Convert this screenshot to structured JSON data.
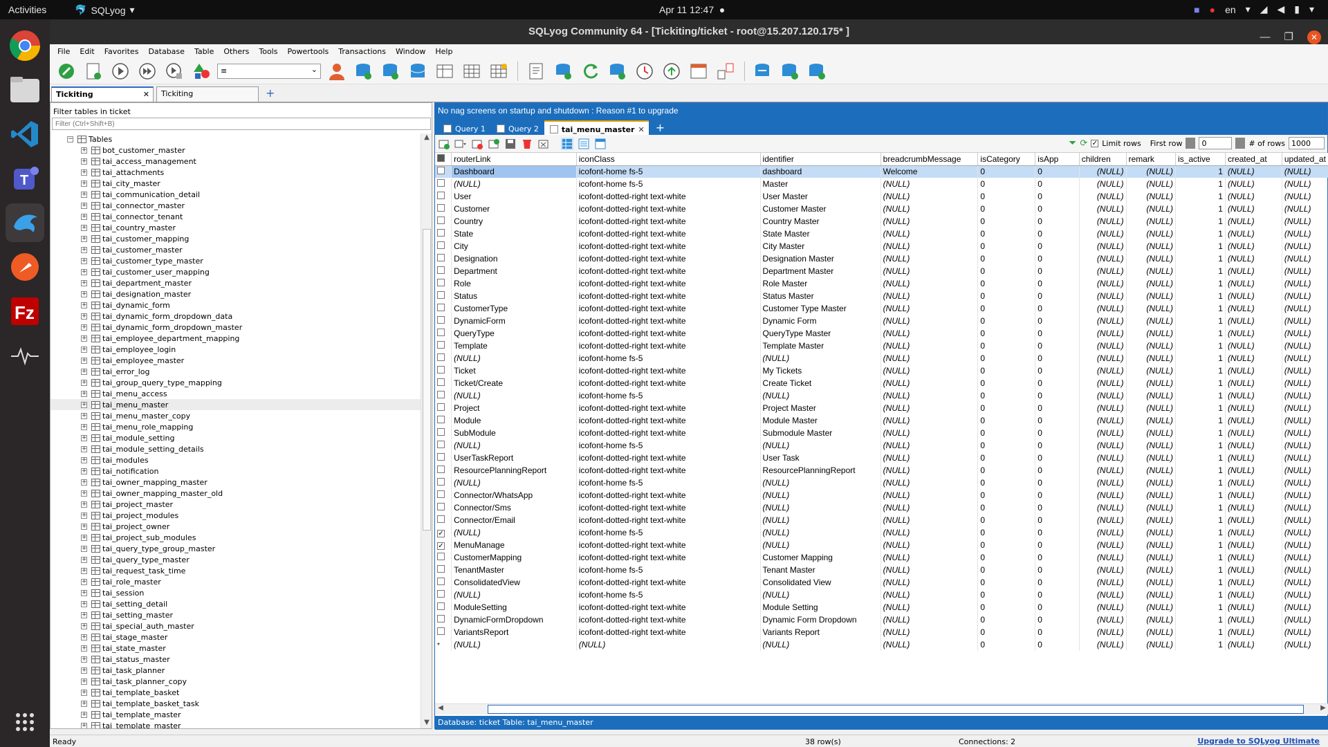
{
  "topbar": {
    "activities": "Activities",
    "app": "SQLyog",
    "clock": "Apr 11  12:47",
    "lang": "en"
  },
  "window": {
    "title": "SQLyog Community 64 - [Tickiting/ticket - root@15.207.120.175* ]"
  },
  "menu": [
    "File",
    "Edit",
    "Favorites",
    "Database",
    "Table",
    "Others",
    "Tools",
    "Powertools",
    "Transactions",
    "Window",
    "Help"
  ],
  "conn_tabs": [
    {
      "label": "Tickiting"
    },
    {
      "label": "Tickiting"
    }
  ],
  "left": {
    "filter_header": "Filter tables in ticket",
    "filter_placeholder": "Filter (Ctrl+Shift+B)",
    "root": "Tables",
    "tables": [
      "bot_customer_master",
      "tai_access_management",
      "tai_attachments",
      "tai_city_master",
      "tai_communication_detail",
      "tai_connector_master",
      "tai_connector_tenant",
      "tai_country_master",
      "tai_customer_mapping",
      "tai_customer_master",
      "tai_customer_type_master",
      "tai_customer_user_mapping",
      "tai_department_master",
      "tai_designation_master",
      "tai_dynamic_form",
      "tai_dynamic_form_dropdown_data",
      "tai_dynamic_form_dropdown_master",
      "tai_employee_department_mapping",
      "tai_employee_login",
      "tai_employee_master",
      "tai_error_log",
      "tai_group_query_type_mapping",
      "tai_menu_access",
      "tai_menu_master",
      "tai_menu_master_copy",
      "tai_menu_role_mapping",
      "tai_module_setting",
      "tai_module_setting_details",
      "tai_modules",
      "tai_notification",
      "tai_owner_mapping_master",
      "tai_owner_mapping_master_old",
      "tai_project_master",
      "tai_project_modules",
      "tai_project_owner",
      "tai_project_sub_modules",
      "tai_query_type_group_master",
      "tai_query_type_master",
      "tai_request_task_time",
      "tai_role_master",
      "tai_session",
      "tai_setting_detail",
      "tai_setting_master",
      "tai_special_auth_master",
      "tai_stage_master",
      "tai_state_master",
      "tai_status_master",
      "tai_task_planner",
      "tai_task_planner_copy",
      "tai_template_basket",
      "tai_template_basket_task",
      "tai_template_master",
      "tai_template_master"
    ],
    "selected_table": "tai_menu_master"
  },
  "right": {
    "nag": "No nag screens on startup and shutdown : Reason #1 to upgrade",
    "query_tabs": [
      "Query 1",
      "Query 2",
      "tai_menu_master"
    ],
    "limit_rows_label": "Limit rows",
    "first_row_label": "First row",
    "first_row_value": "0",
    "rows_label": "# of rows",
    "rows_value": "1000",
    "columns": [
      "routerLink",
      "iconClass",
      "identifier",
      "breadcrumbMessage",
      "isCategory",
      "isApp",
      "children",
      "remark",
      "is_active",
      "created_at",
      "updated_at"
    ],
    "rows": [
      [
        "Dashboard",
        "icofont-home fs-5",
        "dashboard",
        "Welcome",
        "0",
        "0",
        "(NULL)",
        "(NULL)",
        "1",
        "(NULL)",
        "(NULL)"
      ],
      [
        "(NULL)",
        "icofont-home fs-5",
        "Master",
        "(NULL)",
        "0",
        "0",
        "(NULL)",
        "(NULL)",
        "1",
        "(NULL)",
        "(NULL)"
      ],
      [
        "User",
        "icofont-dotted-right text-white",
        "User Master",
        "(NULL)",
        "0",
        "0",
        "(NULL)",
        "(NULL)",
        "1",
        "(NULL)",
        "(NULL)"
      ],
      [
        "Customer",
        "icofont-dotted-right text-white",
        "Customer Master",
        "(NULL)",
        "0",
        "0",
        "(NULL)",
        "(NULL)",
        "1",
        "(NULL)",
        "(NULL)"
      ],
      [
        "Country",
        "icofont-dotted-right text-white",
        "Country Master",
        "(NULL)",
        "0",
        "0",
        "(NULL)",
        "(NULL)",
        "1",
        "(NULL)",
        "(NULL)"
      ],
      [
        "State",
        "icofont-dotted-right text-white",
        "State Master",
        "(NULL)",
        "0",
        "0",
        "(NULL)",
        "(NULL)",
        "1",
        "(NULL)",
        "(NULL)"
      ],
      [
        "City",
        "icofont-dotted-right text-white",
        "City Master",
        "(NULL)",
        "0",
        "0",
        "(NULL)",
        "(NULL)",
        "1",
        "(NULL)",
        "(NULL)"
      ],
      [
        "Designation",
        "icofont-dotted-right text-white",
        "Designation Master",
        "(NULL)",
        "0",
        "0",
        "(NULL)",
        "(NULL)",
        "1",
        "(NULL)",
        "(NULL)"
      ],
      [
        "Department",
        "icofont-dotted-right text-white",
        "Department Master",
        "(NULL)",
        "0",
        "0",
        "(NULL)",
        "(NULL)",
        "1",
        "(NULL)",
        "(NULL)"
      ],
      [
        "Role",
        "icofont-dotted-right text-white",
        "Role Master",
        "(NULL)",
        "0",
        "0",
        "(NULL)",
        "(NULL)",
        "1",
        "(NULL)",
        "(NULL)"
      ],
      [
        "Status",
        "icofont-dotted-right text-white",
        "Status Master",
        "(NULL)",
        "0",
        "0",
        "(NULL)",
        "(NULL)",
        "1",
        "(NULL)",
        "(NULL)"
      ],
      [
        "CustomerType",
        "icofont-dotted-right text-white",
        "Customer Type Master",
        "(NULL)",
        "0",
        "0",
        "(NULL)",
        "(NULL)",
        "1",
        "(NULL)",
        "(NULL)"
      ],
      [
        "DynamicForm",
        "icofont-dotted-right text-white",
        "Dynamic Form",
        "(NULL)",
        "0",
        "0",
        "(NULL)",
        "(NULL)",
        "1",
        "(NULL)",
        "(NULL)"
      ],
      [
        "QueryType",
        "icofont-dotted-right text-white",
        "QueryType Master",
        "(NULL)",
        "0",
        "0",
        "(NULL)",
        "(NULL)",
        "1",
        "(NULL)",
        "(NULL)"
      ],
      [
        "Template",
        "icofont-dotted-right text-white",
        "Template Master",
        "(NULL)",
        "0",
        "0",
        "(NULL)",
        "(NULL)",
        "1",
        "(NULL)",
        "(NULL)"
      ],
      [
        "(NULL)",
        "icofont-home fs-5",
        "(NULL)",
        "(NULL)",
        "0",
        "0",
        "(NULL)",
        "(NULL)",
        "1",
        "(NULL)",
        "(NULL)"
      ],
      [
        "Ticket",
        "icofont-dotted-right text-white",
        "My Tickets",
        "(NULL)",
        "0",
        "0",
        "(NULL)",
        "(NULL)",
        "1",
        "(NULL)",
        "(NULL)"
      ],
      [
        "Ticket/Create",
        "icofont-dotted-right text-white",
        "Create Ticket",
        "(NULL)",
        "0",
        "0",
        "(NULL)",
        "(NULL)",
        "1",
        "(NULL)",
        "(NULL)"
      ],
      [
        "(NULL)",
        "icofont-home fs-5",
        "(NULL)",
        "(NULL)",
        "0",
        "0",
        "(NULL)",
        "(NULL)",
        "1",
        "(NULL)",
        "(NULL)"
      ],
      [
        "Project",
        "icofont-dotted-right text-white",
        "Project Master",
        "(NULL)",
        "0",
        "0",
        "(NULL)",
        "(NULL)",
        "1",
        "(NULL)",
        "(NULL)"
      ],
      [
        "Module",
        "icofont-dotted-right text-white",
        "Module Master",
        "(NULL)",
        "0",
        "0",
        "(NULL)",
        "(NULL)",
        "1",
        "(NULL)",
        "(NULL)"
      ],
      [
        "SubModule",
        "icofont-dotted-right text-white",
        "Submodule Master",
        "(NULL)",
        "0",
        "0",
        "(NULL)",
        "(NULL)",
        "1",
        "(NULL)",
        "(NULL)"
      ],
      [
        "(NULL)",
        "icofont-home fs-5",
        "(NULL)",
        "(NULL)",
        "0",
        "0",
        "(NULL)",
        "(NULL)",
        "1",
        "(NULL)",
        "(NULL)"
      ],
      [
        "UserTaskReport",
        "icofont-dotted-right text-white",
        "User Task",
        "(NULL)",
        "0",
        "0",
        "(NULL)",
        "(NULL)",
        "1",
        "(NULL)",
        "(NULL)"
      ],
      [
        "ResourcePlanningReport",
        "icofont-dotted-right text-white",
        "ResourcePlanningReport",
        "(NULL)",
        "0",
        "0",
        "(NULL)",
        "(NULL)",
        "1",
        "(NULL)",
        "(NULL)"
      ],
      [
        "(NULL)",
        "icofont-home fs-5",
        "(NULL)",
        "(NULL)",
        "0",
        "0",
        "(NULL)",
        "(NULL)",
        "1",
        "(NULL)",
        "(NULL)"
      ],
      [
        "Connector/WhatsApp",
        "icofont-dotted-right text-white",
        "(NULL)",
        "(NULL)",
        "0",
        "0",
        "(NULL)",
        "(NULL)",
        "1",
        "(NULL)",
        "(NULL)"
      ],
      [
        "Connector/Sms",
        "icofont-dotted-right text-white",
        "(NULL)",
        "(NULL)",
        "0",
        "0",
        "(NULL)",
        "(NULL)",
        "1",
        "(NULL)",
        "(NULL)"
      ],
      [
        "Connector/Email",
        "icofont-dotted-right text-white",
        "(NULL)",
        "(NULL)",
        "0",
        "0",
        "(NULL)",
        "(NULL)",
        "1",
        "(NULL)",
        "(NULL)"
      ],
      [
        "(NULL)",
        "icofont-home fs-5",
        "(NULL)",
        "(NULL)",
        "0",
        "0",
        "(NULL)",
        "(NULL)",
        "1",
        "(NULL)",
        "(NULL)"
      ],
      [
        "MenuManage",
        "icofont-dotted-right text-white",
        "(NULL)",
        "(NULL)",
        "0",
        "0",
        "(NULL)",
        "(NULL)",
        "1",
        "(NULL)",
        "(NULL)"
      ],
      [
        "CustomerMapping",
        "icofont-dotted-right text-white",
        "Customer Mapping",
        "(NULL)",
        "0",
        "0",
        "(NULL)",
        "(NULL)",
        "1",
        "(NULL)",
        "(NULL)"
      ],
      [
        "TenantMaster",
        "icofont-home fs-5",
        "Tenant Master",
        "(NULL)",
        "0",
        "0",
        "(NULL)",
        "(NULL)",
        "1",
        "(NULL)",
        "(NULL)"
      ],
      [
        "ConsolidatedView",
        "icofont-dotted-right text-white",
        "Consolidated View",
        "(NULL)",
        "0",
        "0",
        "(NULL)",
        "(NULL)",
        "1",
        "(NULL)",
        "(NULL)"
      ],
      [
        "(NULL)",
        "icofont-home fs-5",
        "(NULL)",
        "(NULL)",
        "0",
        "0",
        "(NULL)",
        "(NULL)",
        "1",
        "(NULL)",
        "(NULL)"
      ],
      [
        "ModuleSetting",
        "icofont-dotted-right text-white",
        "Module Setting",
        "(NULL)",
        "0",
        "0",
        "(NULL)",
        "(NULL)",
        "1",
        "(NULL)",
        "(NULL)"
      ],
      [
        "DynamicFormDropdown",
        "icofont-dotted-right text-white",
        "Dynamic Form Dropdown",
        "(NULL)",
        "0",
        "0",
        "(NULL)",
        "(NULL)",
        "1",
        "(NULL)",
        "(NULL)"
      ],
      [
        "VariantsReport",
        "icofont-dotted-right text-white",
        "Variants Report",
        "(NULL)",
        "0",
        "0",
        "(NULL)",
        "(NULL)",
        "1",
        "(NULL)",
        "(NULL)"
      ],
      [
        "(NULL)",
        "(NULL)",
        "(NULL)",
        "(NULL)",
        "0",
        "0",
        "(NULL)",
        "(NULL)",
        "1",
        "(NULL)",
        "(NULL)"
      ]
    ],
    "checked_rows": [
      29,
      30
    ],
    "selected_row": 0,
    "status_db": "Database: ticket   Table: tai_menu_master"
  },
  "status": {
    "left": "Ready",
    "rows": "38 row(s)",
    "connections": "Connections: 2",
    "upgrade": "Upgrade to SQLyog Ultimate"
  },
  "colors": {
    "accent": "#1c6ebd",
    "selection": "#c5dcf6",
    "close": "#e95420"
  }
}
